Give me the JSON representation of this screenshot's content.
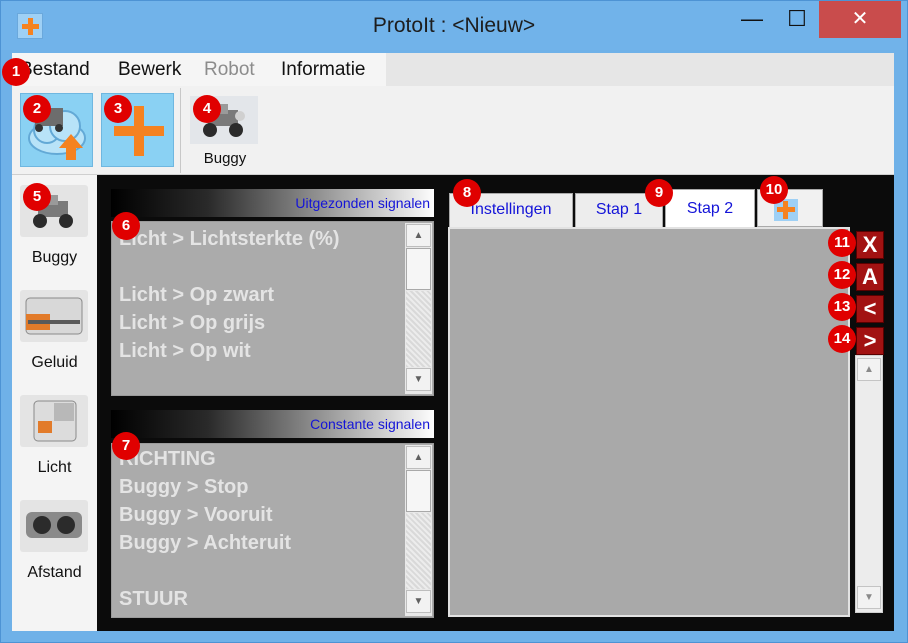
{
  "window": {
    "title": "ProtoIt : <Nieuw>",
    "minimize_label": "—",
    "maximize_label": "☐",
    "close_label": "✕"
  },
  "menu": {
    "items": [
      {
        "label": "Bestand",
        "enabled": true
      },
      {
        "label": "Bewerk",
        "enabled": true
      },
      {
        "label": "Robot",
        "enabled": false
      },
      {
        "label": "Informatie",
        "enabled": true
      }
    ]
  },
  "toolbar": {
    "buttons": [
      {
        "icon": "cloud-upload-icon"
      },
      {
        "icon": "plus-icon"
      }
    ],
    "robot": {
      "label": "Buggy",
      "icon": "buggy-robot-icon"
    }
  },
  "sidebar": {
    "items": [
      {
        "label": "Buggy",
        "icon": "buggy-robot-icon"
      },
      {
        "label": "Geluid",
        "icon": "sound-sensor-icon"
      },
      {
        "label": "Licht",
        "icon": "light-sensor-icon"
      },
      {
        "label": "Afstand",
        "icon": "distance-sensor-icon"
      }
    ]
  },
  "signals": {
    "sent": {
      "header": "Uitgezonden signalen",
      "items": [
        "Licht > Lichtsterkte (%)",
        "",
        "Licht > Op zwart",
        "Licht > Op grijs",
        "Licht > Op wit"
      ]
    },
    "constant": {
      "header": "Constante signalen",
      "items": [
        "RICHTING",
        "Buggy > Stop",
        "Buggy > Vooruit",
        "Buggy > Achteruit",
        "",
        "STUUR"
      ]
    }
  },
  "tabs": {
    "items": [
      {
        "label": "Instellingen",
        "active": false
      },
      {
        "label": "Stap 1",
        "active": false
      },
      {
        "label": "Stap 2",
        "active": true
      }
    ],
    "add_icon": "plus-icon"
  },
  "actions": [
    {
      "label": "X",
      "name": "delete"
    },
    {
      "label": "A",
      "name": "rename"
    },
    {
      "label": "<",
      "name": "move-left"
    },
    {
      "label": ">",
      "name": "move-right"
    }
  ],
  "scroll_arrows": {
    "up": "▲",
    "down": "▼"
  },
  "badges": [
    "1",
    "2",
    "3",
    "4",
    "5",
    "6",
    "7",
    "8",
    "9",
    "10",
    "11",
    "12",
    "13",
    "14"
  ],
  "colors": {
    "titlebar": "#71b3ea",
    "close_button": "#c94c4c",
    "accent_orange": "#f58220",
    "tool_button_bg": "#8ad1f3",
    "signal_header_text": "#1414d8",
    "action_button": "#a21212",
    "badge": "#e00000"
  }
}
